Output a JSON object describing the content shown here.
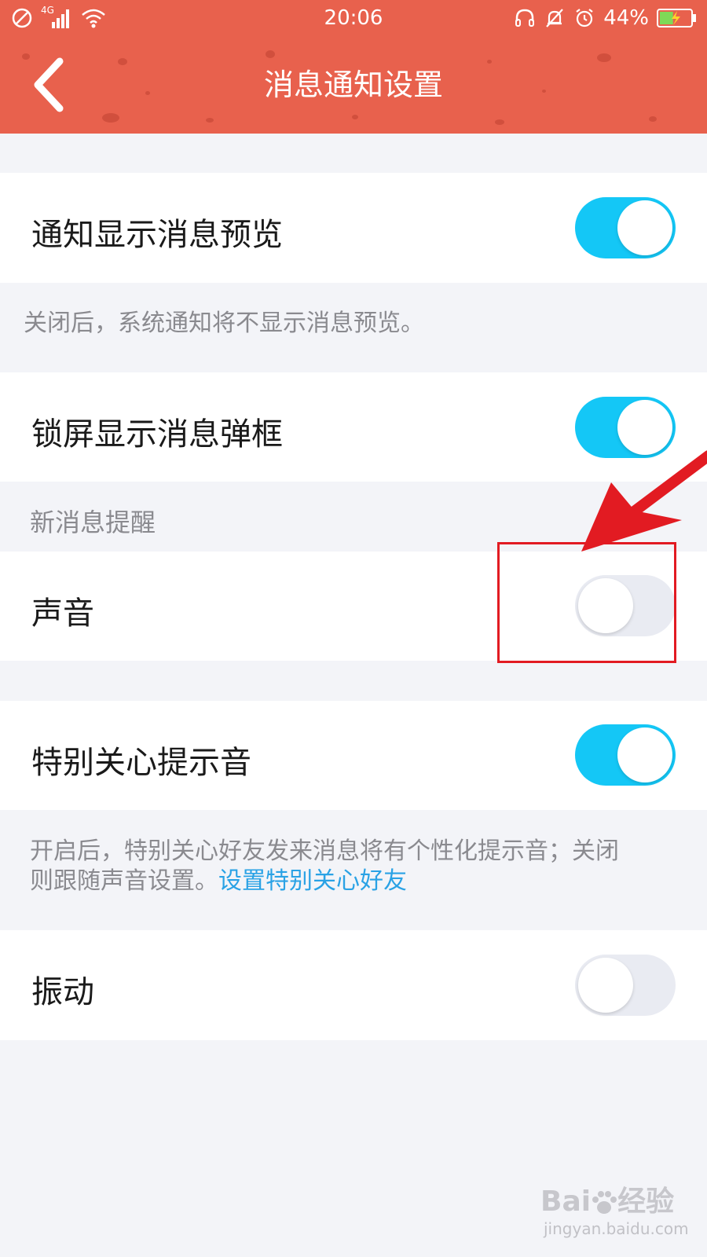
{
  "status_bar": {
    "network_label": "4G",
    "time": "20:06",
    "battery_percent": "44%",
    "battery_level": 0.44,
    "icons": [
      "no-sim-icon",
      "signal-icon",
      "wifi-icon",
      "headset-icon",
      "bell-muted-icon",
      "alarm-icon",
      "battery-charging-icon"
    ]
  },
  "header": {
    "title": "消息通知设置",
    "back_icon": "chevron-left-icon"
  },
  "settings": {
    "preview": {
      "label": "通知显示消息预览",
      "enabled": true,
      "note": "关闭后，系统通知将不显示消息预览。"
    },
    "lockscreen": {
      "label": "锁屏显示消息弹框",
      "enabled": true
    },
    "new_message_section": "新消息提醒",
    "sound": {
      "label": "声音",
      "enabled": false
    },
    "special_care": {
      "label": "特别关心提示音",
      "enabled": true,
      "note_line1": "开启后，特别关心好友发来消息将有个性化提示音；关闭",
      "note_line2": "则跟随声音设置。",
      "note_link": "设置特别关心好友"
    },
    "vibrate": {
      "label": "振动",
      "enabled": false
    }
  },
  "colors": {
    "header": "#e8614d",
    "toggle_on": "#14c7f6",
    "toggle_off": "#e9ebf2",
    "link": "#2aa2e5",
    "annotation": "#e21b22",
    "background": "#f3f4f8"
  },
  "watermark": {
    "brand": "Bai",
    "suffix": "经验",
    "url": "jingyan.baidu.com"
  }
}
